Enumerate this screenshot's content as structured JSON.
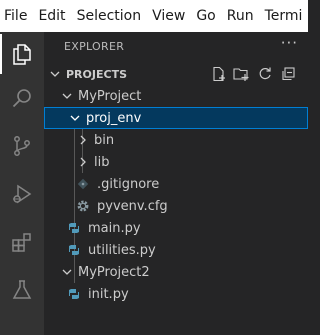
{
  "menubar": {
    "items": [
      "File",
      "Edit",
      "Selection",
      "View",
      "Go",
      "Run",
      "Termi"
    ]
  },
  "activitybar": {
    "icons": [
      "files-icon",
      "search-icon",
      "source-control-icon",
      "run-debug-icon",
      "extensions-icon",
      "testing-icon"
    ]
  },
  "explorer": {
    "title": "EXPLORER",
    "more": "···",
    "section": "PROJECTS",
    "tree": [
      {
        "label": "MyProject",
        "type": "folder",
        "expanded": true
      },
      {
        "label": "proj_env",
        "type": "folder",
        "expanded": true,
        "selected": true
      },
      {
        "label": "bin",
        "type": "folder",
        "expanded": false
      },
      {
        "label": "lib",
        "type": "folder",
        "expanded": false
      },
      {
        "label": ".gitignore",
        "type": "gitignore"
      },
      {
        "label": "pyvenv.cfg",
        "type": "config"
      },
      {
        "label": "main.py",
        "type": "python"
      },
      {
        "label": "utilities.py",
        "type": "python"
      },
      {
        "label": "MyProject2",
        "type": "folder",
        "expanded": true
      },
      {
        "label": "init.py",
        "type": "python"
      }
    ]
  },
  "colors": {
    "selection_bg": "#04395e",
    "selection_border": "#007fd4",
    "python_icon": "#519aba",
    "sidebar_bg": "#252526",
    "activitybar_bg": "#333333"
  }
}
